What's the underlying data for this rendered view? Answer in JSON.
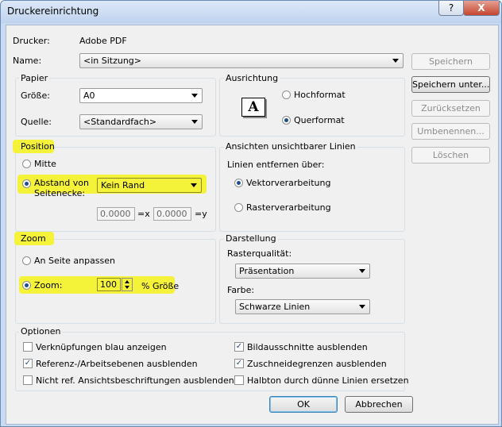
{
  "window": {
    "title": "Druckereinrichtung",
    "help_label": "?",
    "close_label": "X"
  },
  "printer": {
    "label": "Drucker:",
    "value": "Adobe PDF"
  },
  "name": {
    "label": "Name:",
    "value": "<in Sitzung>"
  },
  "side_buttons": {
    "save": "Speichern",
    "save_as": "Speichern unter...",
    "reset": "Zurücksetzen",
    "rename": "Umbenennen...",
    "delete": "Löschen"
  },
  "paper": {
    "title": "Papier",
    "size_label": "Größe:",
    "size_value": "A0",
    "source_label": "Quelle:",
    "source_value": "<Standardfach>"
  },
  "orientation": {
    "title": "Ausrichtung",
    "glyph": "A",
    "portrait": "Hochformat",
    "landscape": "Querformat",
    "selected": "landscape"
  },
  "position": {
    "title": "Position",
    "center": "Mitte",
    "offset_line1": "Abstand von",
    "offset_line2": "Seitenecke:",
    "offset_value": "Kein Rand",
    "x_value": "0.0000 r",
    "x_suffix": "=x",
    "y_value": "0.0000 r",
    "y_suffix": "=y"
  },
  "hidden_lines": {
    "title": "Ansichten unsichtbarer Linien",
    "remove_label": "Linien entfernen über:",
    "vector": "Vektorverarbeitung",
    "raster": "Rasterverarbeitung",
    "selected": "vector"
  },
  "zoom": {
    "title": "Zoom",
    "fit_page": "An Seite anpassen",
    "zoom_label": "Zoom:",
    "zoom_value": "100",
    "percent_label": "% Größe"
  },
  "appearance": {
    "title": "Darstellung",
    "raster_quality_label": "Rasterqualität:",
    "raster_quality_value": "Präsentation",
    "color_label": "Farbe:",
    "color_value": "Schwarze Linien"
  },
  "options": {
    "title": "Optionen",
    "items": [
      {
        "label": "Verknüpfungen blau anzeigen",
        "checked": false
      },
      {
        "label": "Referenz-/Arbeitsebenen ausblenden",
        "checked": true
      },
      {
        "label": "Nicht ref. Ansichtsbeschriftungen ausblenden",
        "checked": false
      },
      {
        "label": "Bildausschnitte ausblenden",
        "checked": true
      },
      {
        "label": "Zuschneidegrenzen ausblenden",
        "checked": true
      },
      {
        "label": "Halbton durch dünne Linien ersetzen",
        "checked": false
      }
    ]
  },
  "footer": {
    "ok": "OK",
    "cancel": "Abbrechen"
  },
  "colors": {
    "highlight": "#f5f23a",
    "radio_selected": "#1f4f8a"
  }
}
